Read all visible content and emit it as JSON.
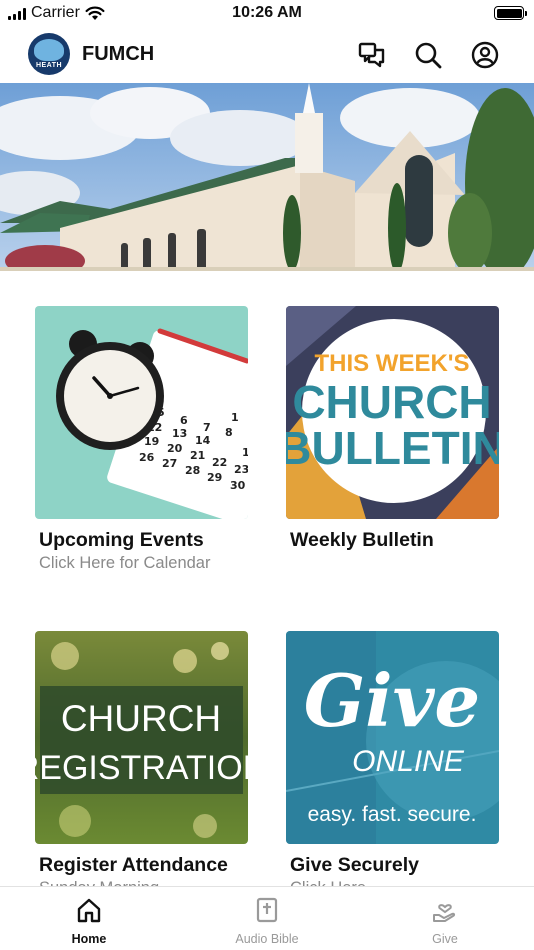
{
  "status_bar": {
    "carrier": "Carrier",
    "time": "10:26 AM"
  },
  "header": {
    "title": "FUMCH",
    "logo_text": "HEATH"
  },
  "tiles": [
    {
      "title": "Upcoming Events",
      "subtitle": "Click Here for Calendar",
      "image": "clock-and-calendar"
    },
    {
      "title": "Weekly Bulletin",
      "subtitle": "",
      "image_text": [
        "THIS WEEK'S",
        "CHURCH",
        "BULLETIN"
      ]
    },
    {
      "title": "Register Attendance",
      "subtitle": "Sunday Morning",
      "image_text": [
        "CHURCH",
        "REGISTRATION"
      ]
    },
    {
      "title": "Give Securely",
      "subtitle": "Click Here",
      "image_text": [
        "Give",
        "ONLINE",
        "easy. fast. secure."
      ]
    }
  ],
  "calendar_numbers": [
    "1",
    "6",
    "7",
    "8",
    "5",
    "12",
    "13",
    "14",
    "15",
    "19",
    "20",
    "21",
    "22",
    "26",
    "27",
    "28",
    "29",
    "30",
    "23"
  ],
  "tab_bar": {
    "tabs": [
      {
        "label": "Home",
        "icon": "home-icon",
        "active": true
      },
      {
        "label": "Audio Bible",
        "icon": "bible-icon",
        "active": false
      },
      {
        "label": "Give",
        "icon": "give-hand-icon",
        "active": false
      }
    ]
  },
  "colors": {
    "active_tab": "#111111",
    "inactive_tab": "#9a9a9a",
    "logo_bg": "#173a6b"
  }
}
